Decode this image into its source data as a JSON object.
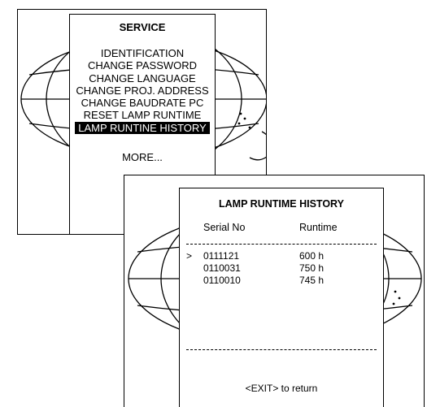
{
  "service_menu": {
    "title": "SERVICE",
    "items": [
      {
        "label": "IDENTIFICATION",
        "selected": false
      },
      {
        "label": "CHANGE PASSWORD",
        "selected": false
      },
      {
        "label": "CHANGE LANGUAGE",
        "selected": false
      },
      {
        "label": "CHANGE PROJ. ADDRESS",
        "selected": false
      },
      {
        "label": "CHANGE BAUDRATE PC",
        "selected": false
      },
      {
        "label": "RESET LAMP RUNTIME",
        "selected": false
      },
      {
        "label": "LAMP RUNTINE HISTORY",
        "selected": true
      }
    ],
    "more_label": "MORE..."
  },
  "lamp_history": {
    "title": "LAMP RUNTIME HISTORY",
    "column_serial": "Serial No",
    "column_runtime": "Runtime",
    "marker": ">",
    "rows": [
      {
        "serial": "0111121",
        "runtime": "600 h",
        "current": true
      },
      {
        "serial": "0110031",
        "runtime": "750 h",
        "current": false
      },
      {
        "serial": "0110010",
        "runtime": "745 h",
        "current": false
      }
    ],
    "exit_hint": "<EXIT> to return"
  },
  "colors": {
    "background": "#ffffff",
    "foreground": "#000000",
    "highlight_bg": "#000000",
    "highlight_fg": "#ffffff"
  }
}
